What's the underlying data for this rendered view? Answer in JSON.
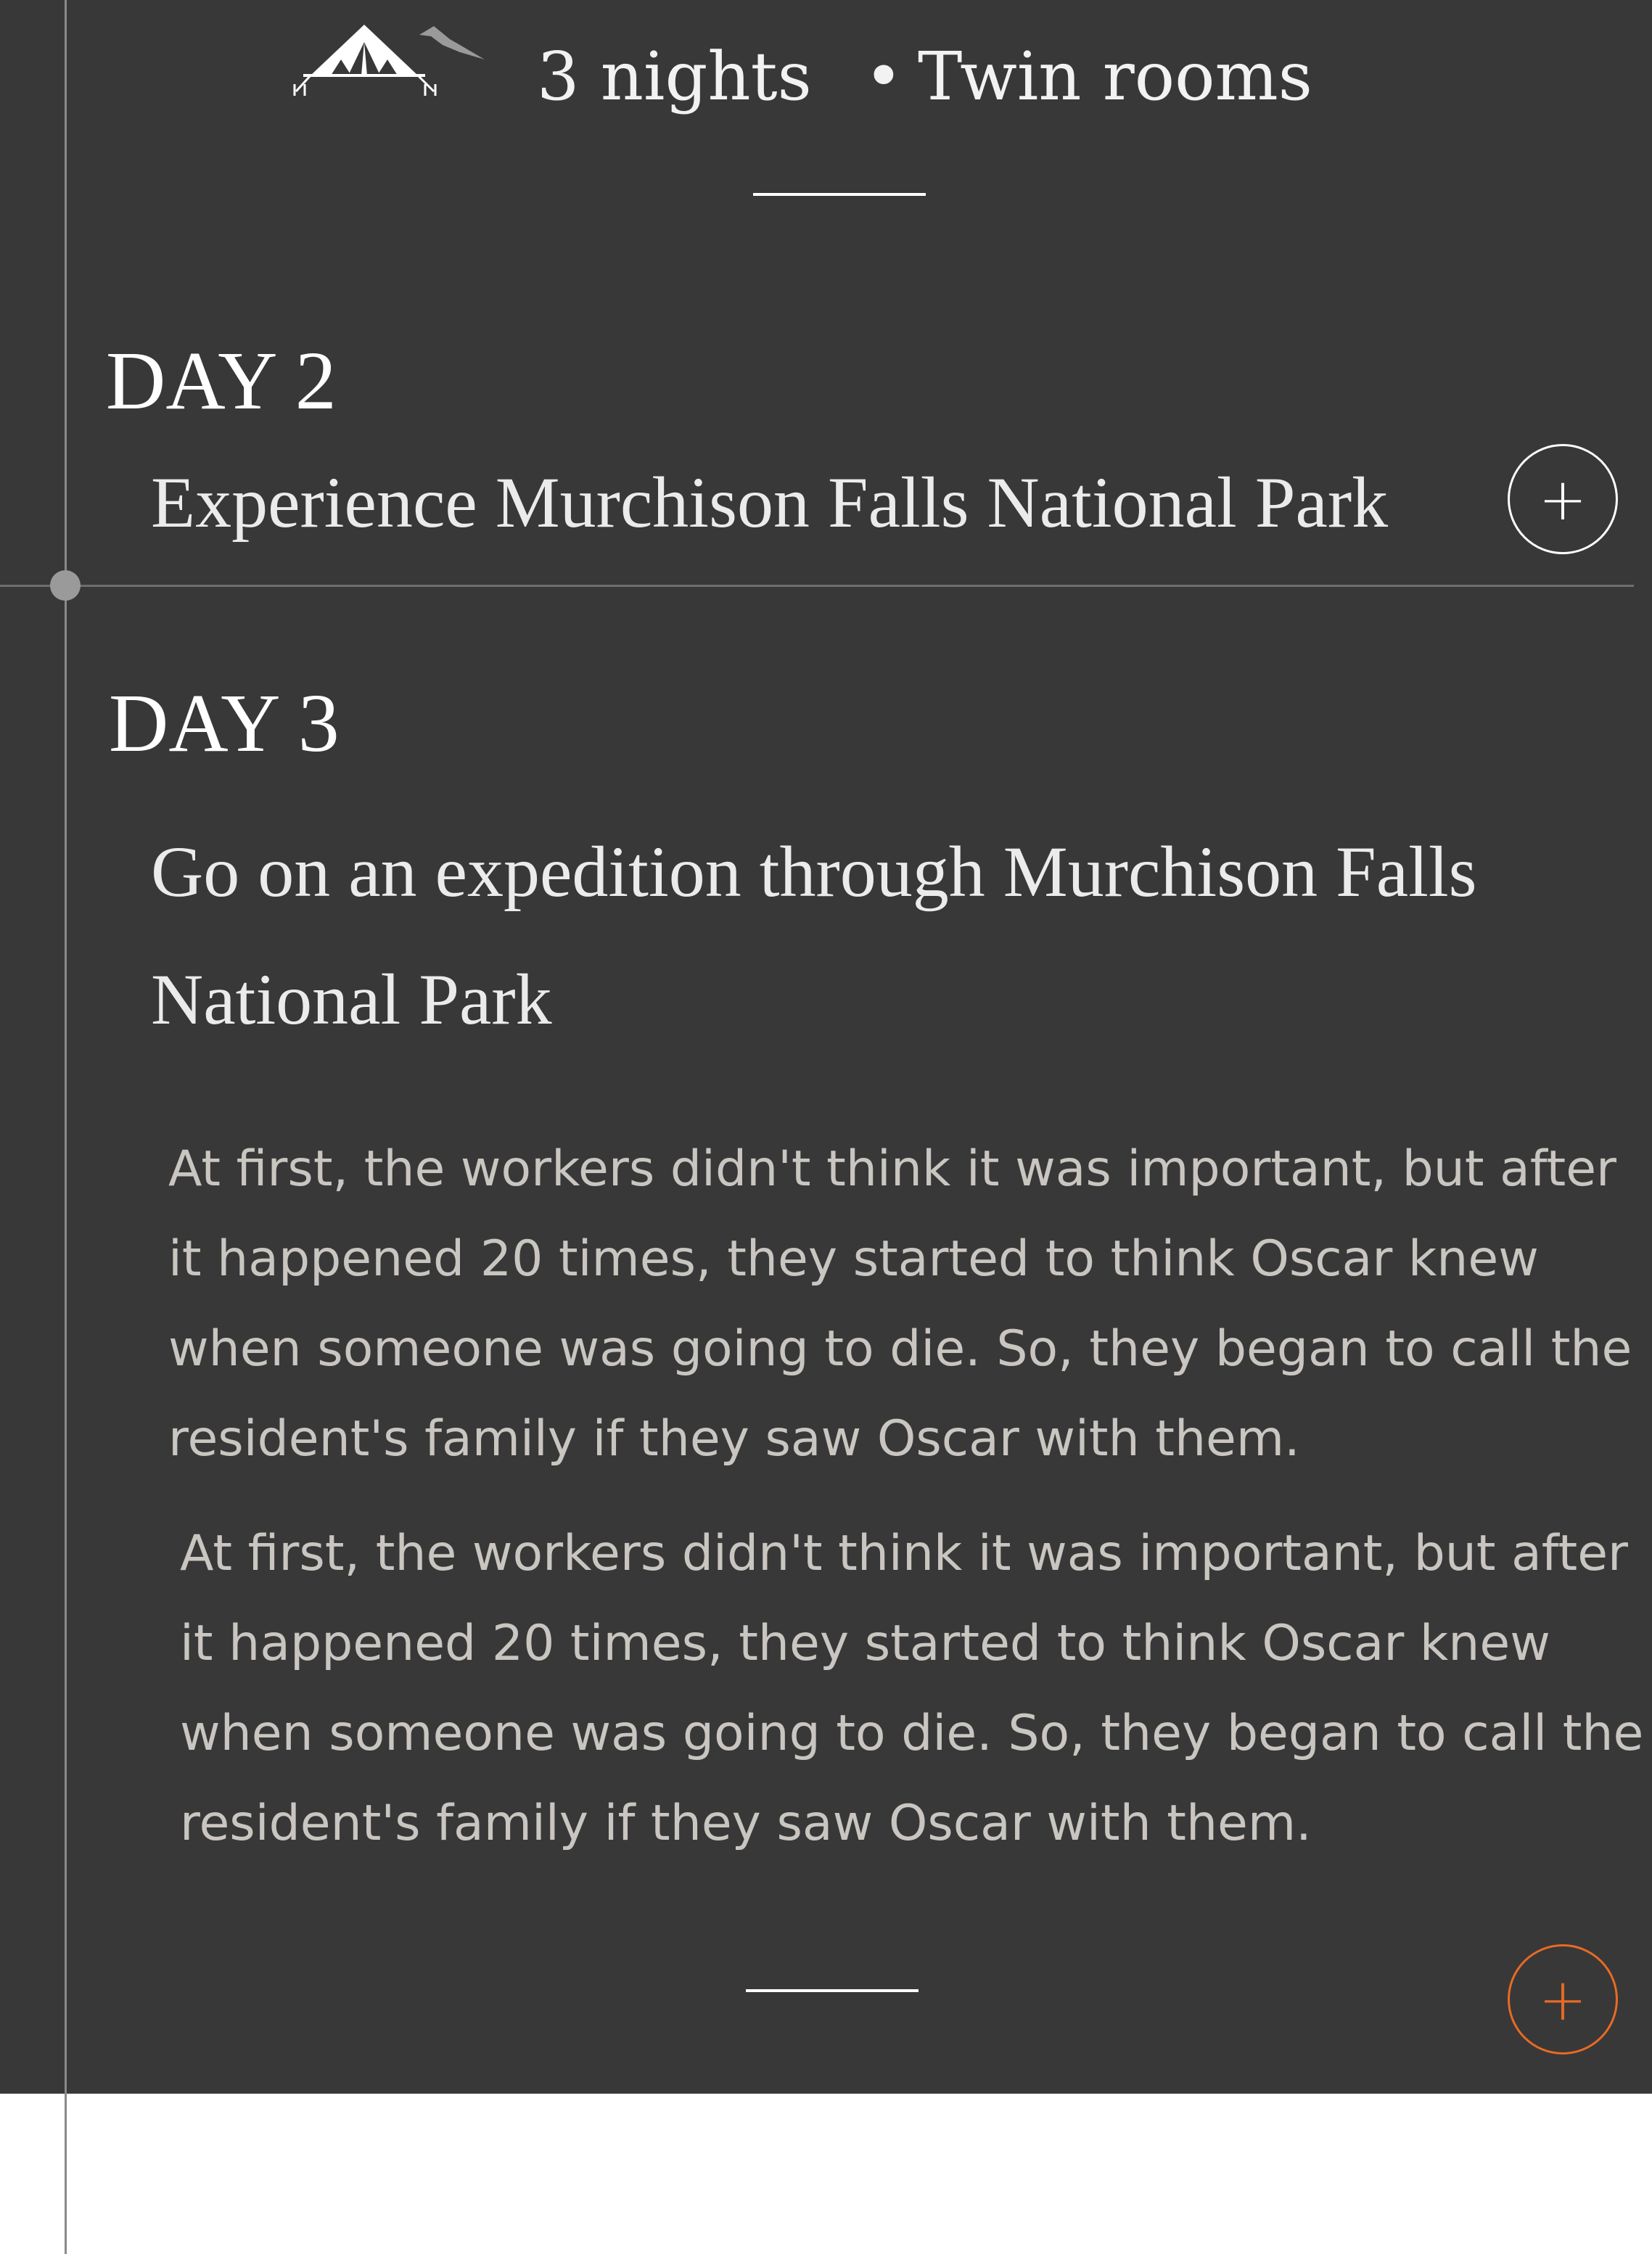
{
  "header": {
    "logo": "tent-with-mountains-logo",
    "nights": "3 nights",
    "bullet": "•",
    "room_type": "Twin rooms"
  },
  "days": [
    {
      "label": "DAY 2",
      "title": "Experience Murchison Falls National Park",
      "toggle": "+",
      "expanded": false
    },
    {
      "label": "DAY 3",
      "title": "Go on an expedition through Murchison Falls National Park",
      "toggle": "+",
      "expanded": true,
      "paragraphs": [
        "At first, the workers didn't think it was important, but after it happened 20 times, they started to think Oscar knew when someone was going to die. So, they began to call the resident's family if they saw Oscar with them.",
        "At first, the workers didn't think it was important, but after it happened 20 times, they started to think Oscar knew when someone was going to die. So, they began to call the resident's family if they saw Oscar with them."
      ]
    }
  ],
  "colors": {
    "background": "#383838",
    "text": "#ebebeb",
    "body_text": "#c9c6c1",
    "accent": "#e86a24",
    "timeline": "#8a8a8a"
  }
}
